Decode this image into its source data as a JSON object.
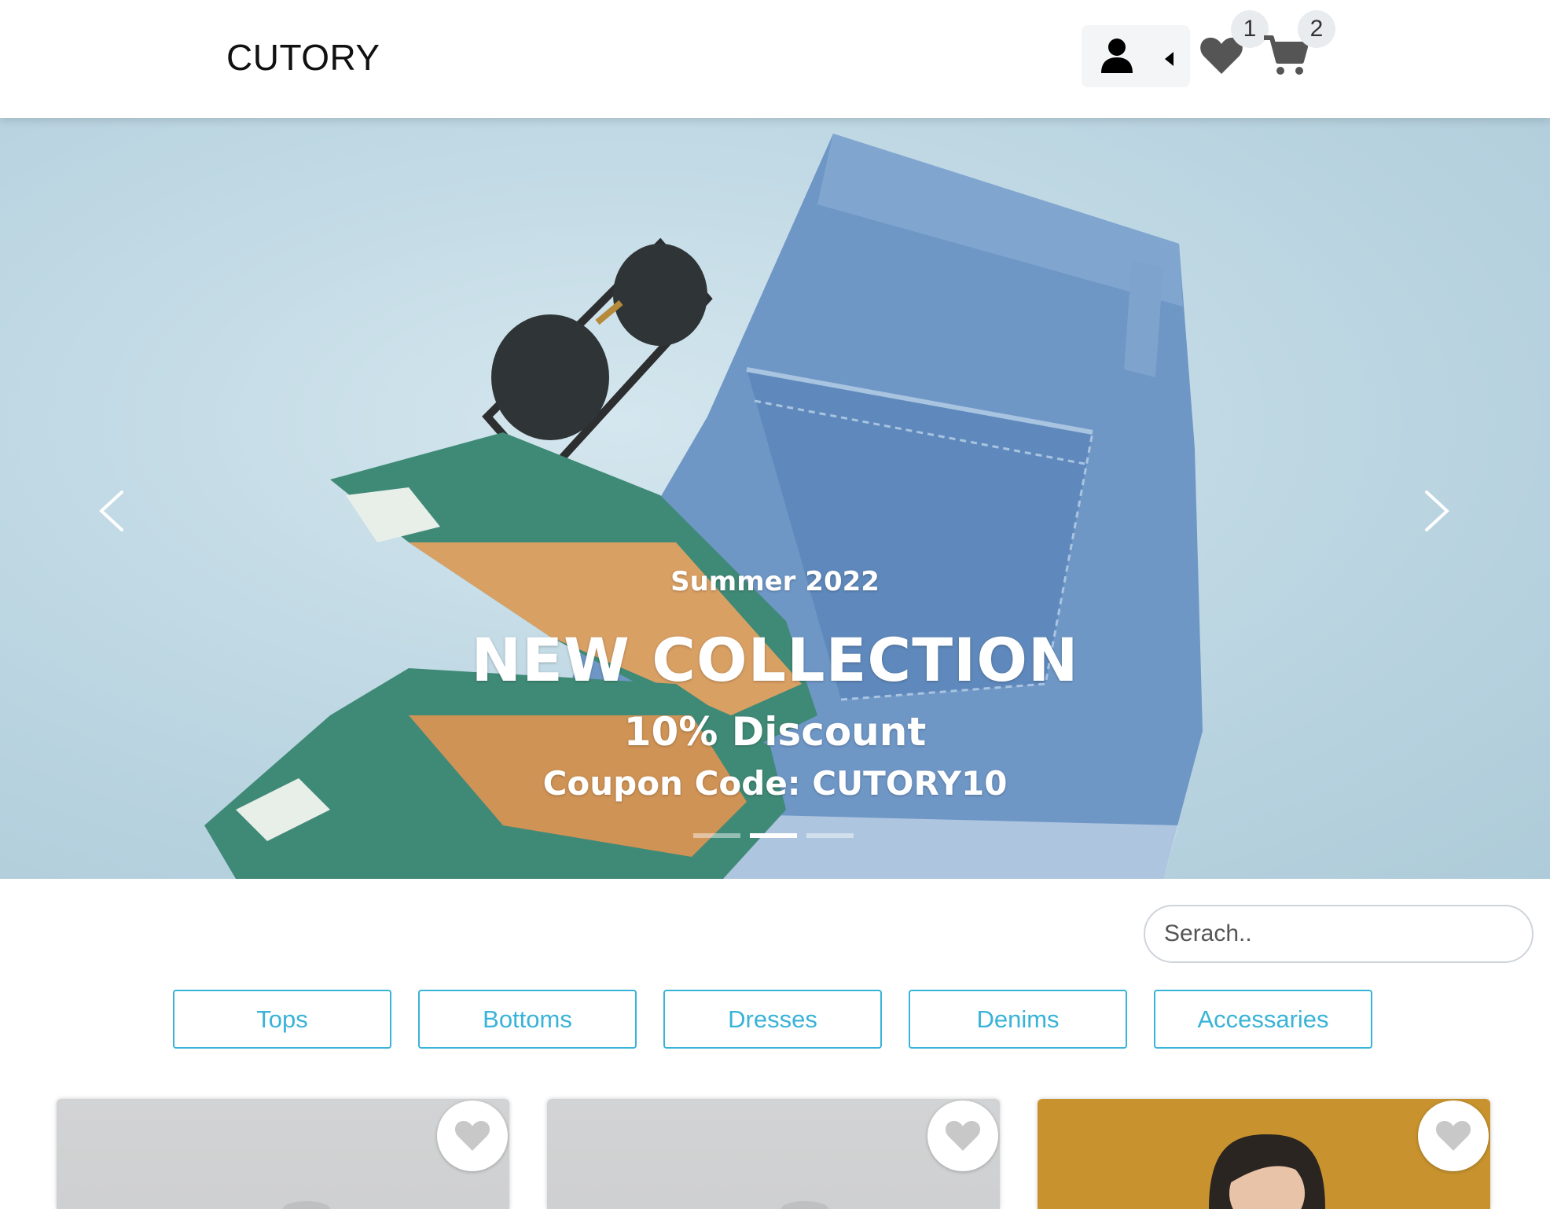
{
  "header": {
    "logo": "CUTORY",
    "wishlist_count": "1",
    "cart_count": "2",
    "icons": [
      "user-icon",
      "caret-left-icon",
      "heart-icon",
      "shopping-cart-icon"
    ]
  },
  "hero": {
    "subtitle": "Summer 2022",
    "title": "NEW COLLECTION",
    "discount": "10% Discount",
    "coupon": "Coupon Code: CUTORY10",
    "slide_count": 3,
    "active_slide": 2
  },
  "search": {
    "placeholder": "Serach.."
  },
  "categories": [
    "Tops",
    "Bottoms",
    "Dresses",
    "Denims",
    "Accessaries"
  ],
  "colors": {
    "accent": "#39b3d7",
    "header_bg": "#ffffff",
    "badge_bg": "#e9ecef",
    "hero_bg": "#bcd6e2"
  }
}
